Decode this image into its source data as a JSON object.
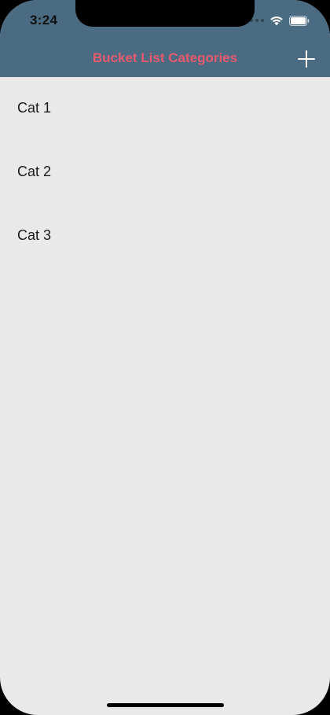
{
  "status_bar": {
    "time": "3:24"
  },
  "nav": {
    "title": "Bucket List Categories"
  },
  "categories": [
    {
      "label": "Cat 1"
    },
    {
      "label": "Cat 2"
    },
    {
      "label": "Cat 3"
    }
  ],
  "colors": {
    "navbar": "#4b6b82",
    "title": "#e85a6e",
    "background": "#e9e9e9"
  },
  "icons": {
    "add": "plus-icon",
    "wifi": "wifi-icon",
    "battery": "battery-icon"
  }
}
